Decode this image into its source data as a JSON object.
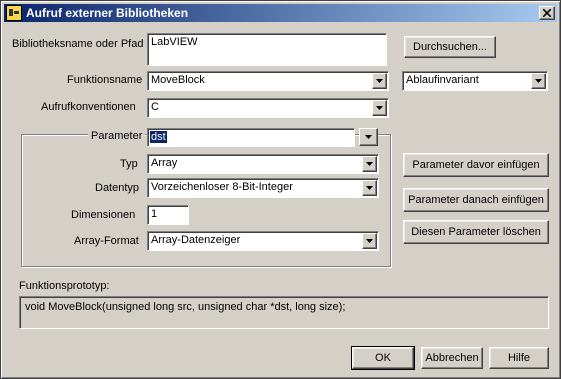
{
  "window": {
    "title": "Aufruf externer Bibliotheken"
  },
  "library": {
    "label": "Bibliotheksname oder Pfad",
    "value": "LabVIEW",
    "browse_button": "Durchsuchen..."
  },
  "function": {
    "label": "Funktionsname",
    "value": "MoveBlock",
    "reentrancy_value": "Ablaufinvariant"
  },
  "calling_convention": {
    "label": "Aufrufkonventionen",
    "value": "C"
  },
  "parameter": {
    "label": "Parameter",
    "value": "dst",
    "type_label": "Typ",
    "type_value": "Array",
    "datatype_label": "Datentyp",
    "datatype_value": "Vorzeichenloser 8-Bit-Integer",
    "dimensions_label": "Dimensionen",
    "dimensions_value": "1",
    "array_format_label": "Array-Format",
    "array_format_value": "Array-Datenzeiger"
  },
  "param_buttons": {
    "add_before": "Parameter davor einfügen",
    "add_after": "Parameter danach einfügen",
    "delete": "Diesen Parameter löschen"
  },
  "prototype": {
    "label": "Funktionsprototyp:",
    "value": "void MoveBlock(unsigned long src, unsigned char *dst, long size);"
  },
  "dialog_buttons": {
    "ok": "OK",
    "cancel": "Abbrechen",
    "help": "Hilfe"
  },
  "colors": {
    "titlebar_start": "#0a246a",
    "titlebar_end": "#a6caf0",
    "face": "#d4d0c8"
  }
}
